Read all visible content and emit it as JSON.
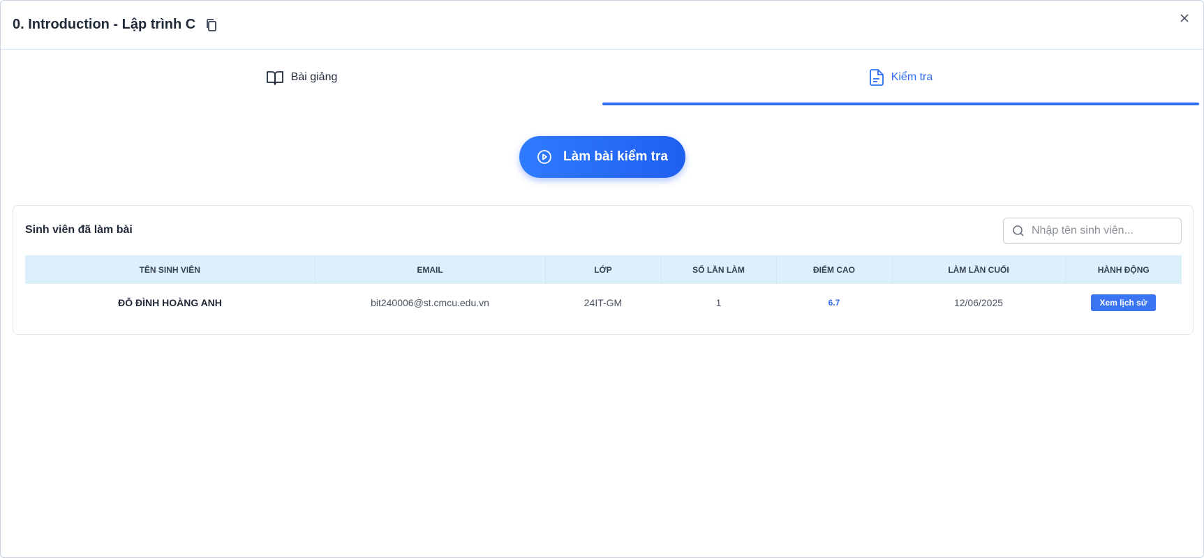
{
  "header": {
    "title": "0. Introduction - Lập trình C"
  },
  "tabs": [
    {
      "label": "Bài giảng",
      "icon": "book-open-icon",
      "active": false
    },
    {
      "label": "Kiểm tra",
      "icon": "file-text-icon",
      "active": true
    }
  ],
  "start_button": {
    "label": "Làm bài kiểm tra",
    "icon": "play-circle-icon"
  },
  "card": {
    "title": "Sinh viên đã làm bài",
    "search_placeholder": "Nhập tên sinh viên..."
  },
  "table": {
    "columns": [
      "TÊN SINH VIÊN",
      "EMAIL",
      "LỚP",
      "SỐ LẦN LÀM",
      "ĐIỂM CAO",
      "LÀM LẦN CUỐI",
      "HÀNH ĐỘNG"
    ],
    "rows": [
      {
        "name": "ĐỖ ĐÌNH HOÀNG ANH",
        "email": "bit240006@st.cmcu.edu.vn",
        "class": "24IT-GM",
        "attempts": "1",
        "high_score": "6.7",
        "last_attempt": "12/06/2025",
        "action": "Xem lịch sử"
      }
    ]
  },
  "colors": {
    "accent": "#2f6ef5",
    "table_header_bg": "#dcf0fc"
  }
}
